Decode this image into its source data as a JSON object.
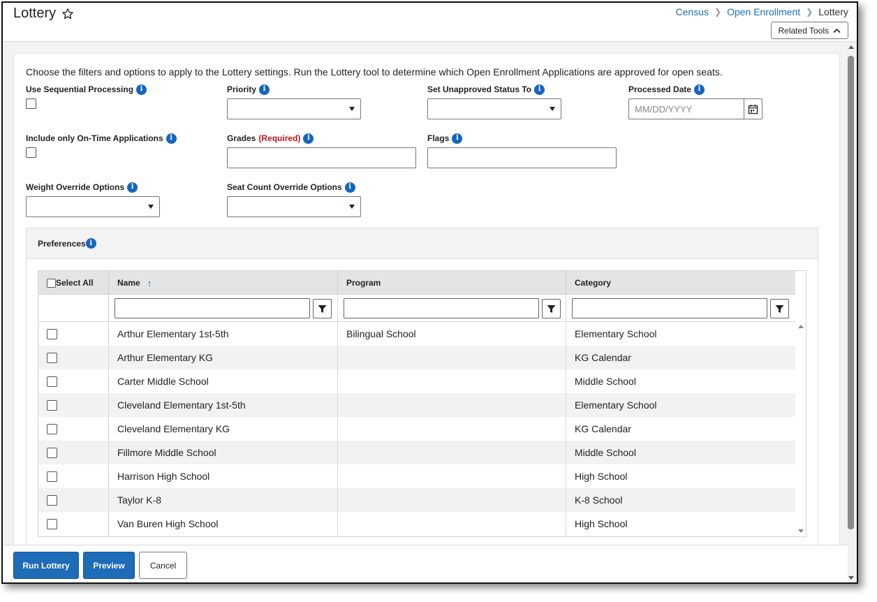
{
  "header": {
    "title": "Lottery",
    "breadcrumb": [
      "Census",
      "Open Enrollment",
      "Lottery"
    ],
    "related_tools_label": "Related Tools"
  },
  "form": {
    "intro": "Choose the filters and options to apply to the Lottery settings. Run the Lottery tool to determine which Open Enrollment Applications are approved for open seats.",
    "use_sequential_processing": "Use Sequential Processing",
    "priority": "Priority",
    "set_unapproved_status": "Set Unapproved Status To",
    "processed_date": "Processed Date",
    "processed_date_placeholder": "MM/DD/YYYY",
    "include_on_time": "Include only On-Time Applications",
    "grades": "Grades",
    "grades_required": "(Required)",
    "flags": "Flags",
    "weight_override": "Weight Override Options",
    "seat_count_override": "Seat Count Override Options"
  },
  "preferences": {
    "title": "Preferences",
    "columns": {
      "select_all": "Select All",
      "name": "Name",
      "program": "Program",
      "category": "Category"
    },
    "rows": [
      {
        "name": "Arthur Elementary 1st-5th",
        "program": "Bilingual School",
        "category": "Elementary School"
      },
      {
        "name": "Arthur Elementary KG",
        "program": "",
        "category": "KG Calendar"
      },
      {
        "name": "Carter Middle School",
        "program": "",
        "category": "Middle School"
      },
      {
        "name": "Cleveland Elementary 1st-5th",
        "program": "",
        "category": "Elementary School"
      },
      {
        "name": "Cleveland Elementary KG",
        "program": "",
        "category": "KG Calendar"
      },
      {
        "name": "Fillmore Middle School",
        "program": "",
        "category": "Middle School"
      },
      {
        "name": "Harrison High School",
        "program": "",
        "category": "High School"
      },
      {
        "name": "Taylor K-8",
        "program": "",
        "category": "K-8 School"
      },
      {
        "name": "Van Buren High School",
        "program": "",
        "category": "High School"
      }
    ]
  },
  "footer": {
    "run_lottery": "Run Lottery",
    "preview": "Preview",
    "cancel": "Cancel"
  },
  "colors": {
    "accent": "#1e6bb8",
    "info": "#1565c0",
    "required": "#c0151b"
  }
}
